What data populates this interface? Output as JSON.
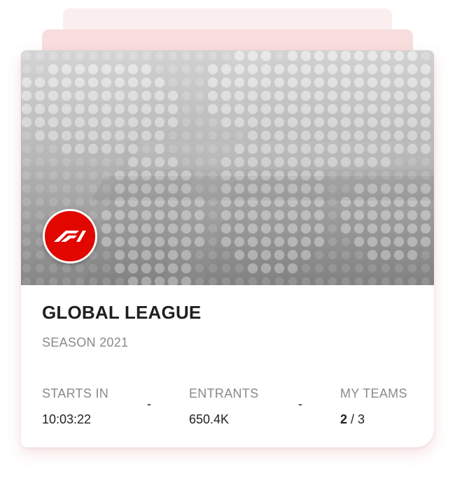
{
  "league_card": {
    "title": "GLOBAL LEAGUE",
    "season": "SEASON 2021",
    "logo_icon": "f1-logo-icon",
    "brand_color": "#e10600",
    "stats": {
      "starts_in": {
        "label": "STARTS IN",
        "value": "10:03:22"
      },
      "separator": "-",
      "entrants": {
        "label": "ENTRANTS",
        "value": "650.4K"
      },
      "my_teams": {
        "label": "MY TEAMS",
        "current": "2",
        "rest": " / 3"
      }
    }
  }
}
